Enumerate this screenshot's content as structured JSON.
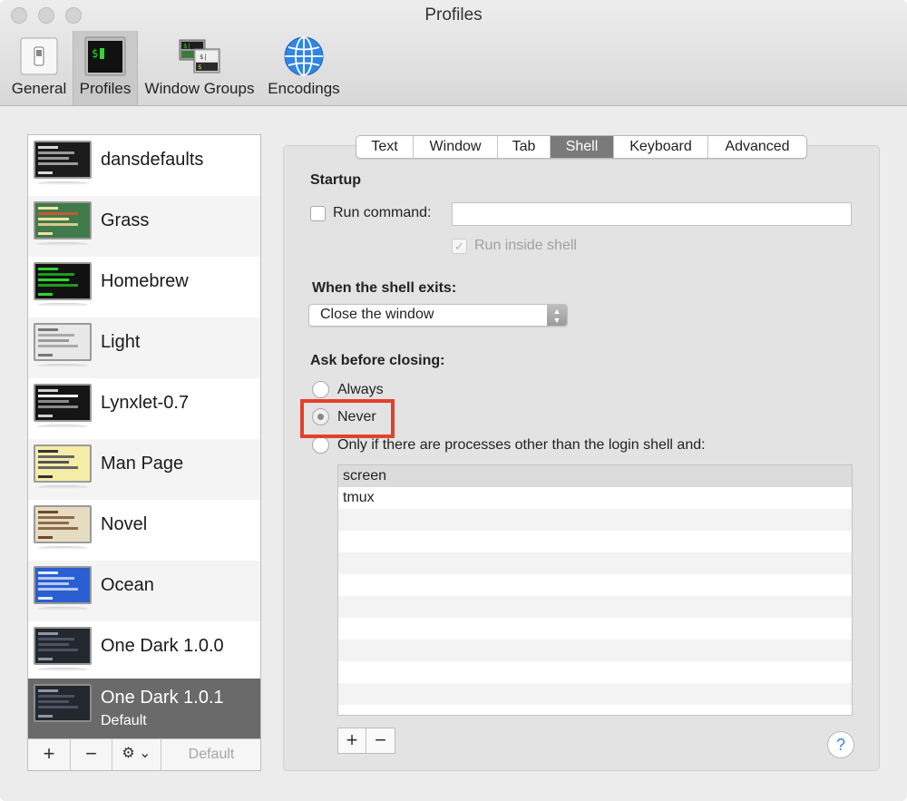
{
  "window": {
    "title": "Profiles"
  },
  "toolbar": {
    "items": [
      {
        "label": "General",
        "icon": "general-switch-icon"
      },
      {
        "label": "Profiles",
        "icon": "terminal-profile-icon",
        "selected": true
      },
      {
        "label": "Window Groups",
        "icon": "window-groups-icon"
      },
      {
        "label": "Encodings",
        "icon": "globe-icon"
      }
    ]
  },
  "profiles": {
    "items": [
      {
        "name": "dansdefaults",
        "theme_bg": "#1b1b1b",
        "theme_fg": "#d8d8d8"
      },
      {
        "name": "Grass",
        "theme_bg": "#3f7a4a",
        "theme_fg": "#f0e2a0"
      },
      {
        "name": "Homebrew",
        "theme_bg": "#111111",
        "theme_fg": "#2fd42f"
      },
      {
        "name": "Light",
        "theme_bg": "#e8e8e8",
        "theme_fg": "#555555"
      },
      {
        "name": "Lynxlet-0.7",
        "theme_bg": "#151515",
        "theme_fg": "#cfcfcf"
      },
      {
        "name": "Man Page",
        "theme_bg": "#f5eca6",
        "theme_fg": "#333333"
      },
      {
        "name": "Novel",
        "theme_bg": "#e6dcc2",
        "theme_fg": "#6b4a2a"
      },
      {
        "name": "Ocean",
        "theme_bg": "#2a5fd1",
        "theme_fg": "#e6ecff"
      },
      {
        "name": "One Dark 1.0.0",
        "theme_bg": "#23272e",
        "theme_fg": "#8f96a3"
      },
      {
        "name": "One Dark 1.0.1",
        "subtitle": "Default",
        "theme_bg": "#23272e",
        "theme_fg": "#8f96a3",
        "selected": true
      }
    ],
    "footer": {
      "add": "+",
      "remove": "−",
      "gear": "⚙︎ ⌄",
      "default": "Default"
    }
  },
  "tabs": {
    "items": [
      "Text",
      "Window",
      "Tab",
      "Shell",
      "Keyboard",
      "Advanced"
    ],
    "active": "Shell"
  },
  "shell": {
    "startup_heading": "Startup",
    "run_command_label": "Run command:",
    "run_command_value": "",
    "run_inside_shell_label": "Run inside shell",
    "exit_heading": "When the shell exits:",
    "exit_action": "Close the window",
    "ask_heading": "Ask before closing:",
    "ask_options": {
      "always": "Always",
      "never": "Never",
      "only_if": "Only if there are processes other than the login shell and:"
    },
    "ask_selected": "never",
    "processes": [
      "screen",
      "tmux"
    ],
    "add": "+",
    "remove": "−",
    "help": "?"
  },
  "colors": {
    "highlight": "#e3412b",
    "selection": "#6a6a6a",
    "active_tab": "#7a7a7a"
  }
}
